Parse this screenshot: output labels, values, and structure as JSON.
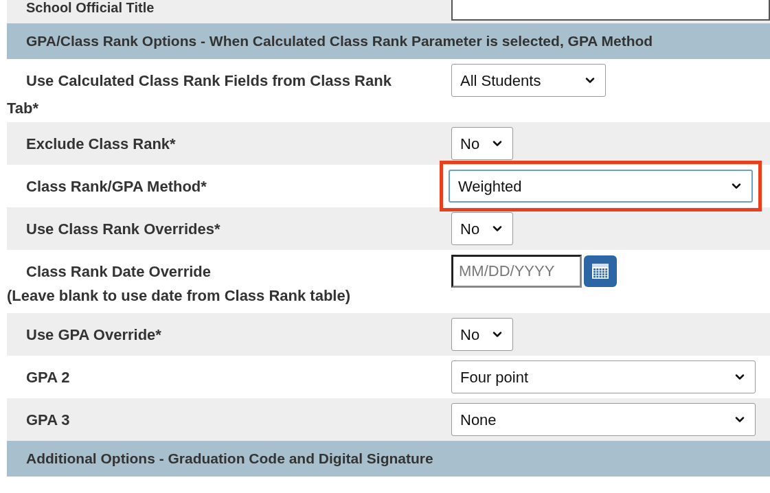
{
  "top_row": {
    "label": "School Official Title",
    "field": {
      "kind": "text"
    }
  },
  "sections": [
    {
      "title": "GPA/Class Rank Options - When Calculated Class Rank Parameter is selected, GPA Method",
      "rows": [
        {
          "label": "Use Calculated Class Rank Fields from Class Rank Tab*",
          "field": {
            "kind": "select",
            "value": "All Students",
            "focused": false
          }
        },
        {
          "label": "Exclude Class Rank*",
          "field": {
            "kind": "short-select",
            "value": "No",
            "focused": false
          }
        },
        {
          "label": "Class Rank/GPA Method*",
          "field": {
            "kind": "wide-select",
            "value": "Weighted",
            "highlighted": true,
            "focused": true
          }
        },
        {
          "label": "Use Class Rank Overrides*",
          "field": {
            "kind": "short-select",
            "value": "No",
            "focused": false
          }
        },
        {
          "label": "Class Rank Date Override",
          "note": "(Leave blank to use date from Class Rank table)",
          "field": {
            "kind": "date",
            "placeholder": "MM/DD/YYYY"
          }
        },
        {
          "label": "Use GPA Override*",
          "field": {
            "kind": "short-select",
            "value": "No",
            "focused": false
          }
        },
        {
          "label": "GPA 2",
          "field": {
            "kind": "wide-select",
            "value": "Four point",
            "focused": false
          }
        },
        {
          "label": "GPA 3",
          "field": {
            "kind": "wide-select",
            "value": "None",
            "focused": false
          }
        }
      ]
    },
    {
      "title": "Additional Options - Graduation Code and Digital Signature"
    }
  ]
}
